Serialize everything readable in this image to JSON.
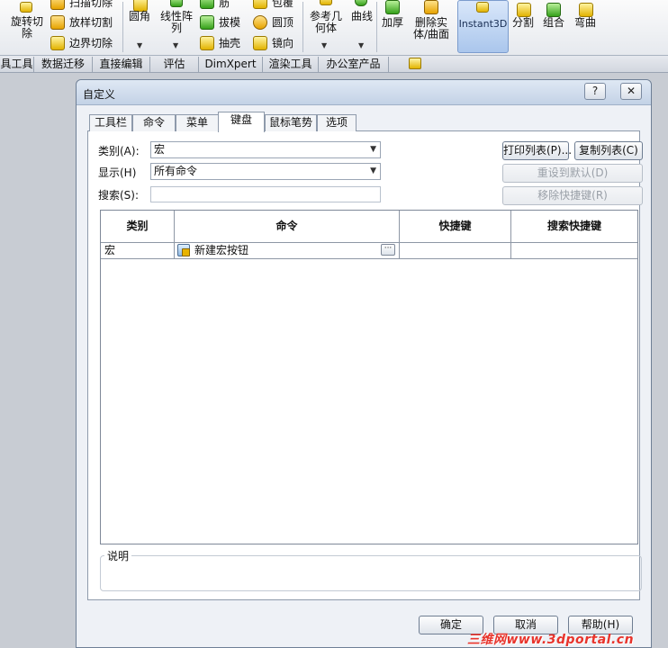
{
  "ribbon": {
    "col1": [
      "旋转切",
      "除"
    ],
    "col2": [
      "扫描切除",
      "放样切割",
      "边界切除"
    ],
    "col3_label": "圆角",
    "col4": [
      "线性阵",
      "列"
    ],
    "col5": [
      "筋",
      "拔模",
      "抽壳"
    ],
    "col6": [
      "包覆",
      "圆顶",
      "镜向"
    ],
    "col7": [
      "参考几",
      "何体"
    ],
    "col8_label": "曲线",
    "col9_label": "加厚",
    "col10": [
      "删除实",
      "体/曲面"
    ],
    "instant3d_label": "Instant3D",
    "col12_label": "分割",
    "col13_label": "组合",
    "col14_label": "弯曲"
  },
  "command_tabs": [
    "具工具",
    "数据迁移",
    "直接编辑",
    "评估",
    "DimXpert",
    "渲染工具",
    "办公室产品"
  ],
  "dialog": {
    "title": "自定义",
    "help_glyph": "?",
    "close_glyph": "✕",
    "tabs": [
      "工具栏",
      "命令",
      "菜单",
      "键盘",
      "鼠标笔势",
      "选项"
    ],
    "active_tab_index": 3,
    "category_label": "类别(A):",
    "category_value": "宏",
    "show_label": "显示(H)",
    "show_value": "所有命令",
    "search_label": "搜索(S):",
    "search_value": "",
    "print_list_button": "打印列表(P)...",
    "copy_list_button": "复制列表(C)",
    "reset_default_button": "重设到默认(D)",
    "remove_shortcut_button": "移除快捷键(R)",
    "table": {
      "columns": [
        "类别",
        "命令",
        "快捷键",
        "搜索快捷键"
      ],
      "rows": [
        {
          "category": "宏",
          "command": "新建宏按钮",
          "shortcut": "",
          "search_shortcut": ""
        }
      ]
    },
    "description_label": "说明",
    "ok_button": "确定",
    "cancel_button": "取消",
    "help_button": "帮助(H)"
  },
  "watermark": "三维网www.3dportal.cn",
  "colors": {
    "watermark": "#e8342c",
    "instant3d_bg": "#aac6ec"
  }
}
